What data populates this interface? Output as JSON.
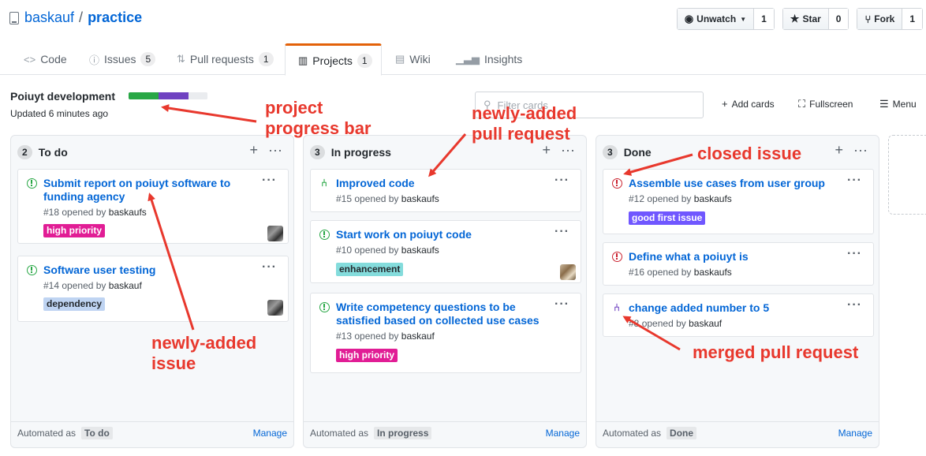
{
  "repo": {
    "owner": "baskauf",
    "separator": "/",
    "name": "practice"
  },
  "actions": {
    "watch": {
      "label": "Unwatch",
      "count": "1"
    },
    "star": {
      "label": "Star",
      "count": "0"
    },
    "fork": {
      "label": "Fork",
      "count": "1"
    }
  },
  "tabs": [
    {
      "label": "Code",
      "icon": "<>"
    },
    {
      "label": "Issues",
      "count": "5"
    },
    {
      "label": "Pull requests",
      "count": "1"
    },
    {
      "label": "Projects",
      "count": "1",
      "selected": true
    },
    {
      "label": "Wiki"
    },
    {
      "label": "Insights"
    }
  ],
  "project": {
    "name": "Poiuyt development",
    "updated": "Updated 6 minutes ago",
    "progress": {
      "done": 0.38,
      "in_progress": 0.38,
      "todo": 0.24
    },
    "progress_colors": {
      "done": "#28a745",
      "in_progress": "#6f42c1",
      "todo": "#eaecef"
    }
  },
  "toolbar": {
    "filter_placeholder": "Filter cards",
    "add_cards": "Add cards",
    "fullscreen": "Fullscreen",
    "menu": "Menu"
  },
  "columns": [
    {
      "count": "2",
      "title": "To do",
      "automated_label": "Automated as",
      "automated_value": "To do",
      "manage": "Manage",
      "cards": [
        {
          "title": "Submit report on poiuyt software to funding agency",
          "number": "#18",
          "opened_by": "opened by",
          "author": "baskaufs",
          "label": "high priority"
        },
        {
          "title": "Software user testing",
          "number": "#14",
          "opened_by": "opened by",
          "author": "baskauf",
          "label": "dependency"
        }
      ]
    },
    {
      "count": "3",
      "title": "In progress",
      "automated_label": "Automated as",
      "automated_value": "In progress",
      "manage": "Manage",
      "cards": [
        {
          "title": "Improved code",
          "number": "#15",
          "opened_by": "opened by",
          "author": "baskaufs"
        },
        {
          "title": "Start work on poiuyt code",
          "number": "#10",
          "opened_by": "opened by",
          "author": "baskaufs",
          "label": "enhancement"
        },
        {
          "title": "Write competency questions to be satisfied based on collected use cases",
          "number": "#13",
          "opened_by": "opened by",
          "author": "baskauf",
          "label": "high priority"
        }
      ]
    },
    {
      "count": "3",
      "title": "Done",
      "automated_label": "Automated as",
      "automated_value": "Done",
      "manage": "Manage",
      "cards": [
        {
          "title": "Assemble use cases from user group",
          "number": "#12",
          "opened_by": "opened by",
          "author": "baskaufs",
          "label": "good first issue"
        },
        {
          "title": "Define what a poiuyt is",
          "number": "#16",
          "opened_by": "opened by",
          "author": "baskaufs"
        },
        {
          "title": "change added number to 5",
          "number": "#8",
          "opened_by": "opened by",
          "author": "baskauf"
        }
      ]
    }
  ],
  "annotations": {
    "progress_bar": "project\nprogress bar",
    "new_pr": "newly-added\npull request",
    "closed_issue": "closed issue",
    "new_issue": "newly-added\nissue",
    "merged_pr": "merged pull request"
  },
  "colors": {
    "link": "#0366d6",
    "high_priority": "#e11d95",
    "dependency": "#bfd4f2",
    "enhancement": "#84dcdc",
    "good_first_issue": "#7057ff",
    "annotation": "#e8382d",
    "tab_accent": "#e36209"
  }
}
